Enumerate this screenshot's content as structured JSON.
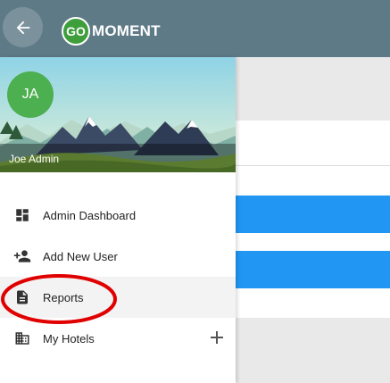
{
  "appbar": {
    "logo_go": "GO",
    "logo_text": "MOMENT"
  },
  "drawer": {
    "avatar_initials": "JA",
    "user_name": "Joe Admin",
    "items": [
      {
        "label": "Admin Dashboard",
        "icon": "dashboard-icon"
      },
      {
        "label": "Add New User",
        "icon": "person-add-icon"
      },
      {
        "label": "Reports",
        "icon": "document-icon",
        "active": true
      },
      {
        "label": "My Hotels",
        "icon": "hotel-building-icon",
        "expand_icon": "plus-icon"
      }
    ]
  },
  "colors": {
    "appbar": "#5f7a87",
    "avatar": "#4caf50",
    "primary_blue": "#2196f3",
    "annotation": "#e00000"
  }
}
